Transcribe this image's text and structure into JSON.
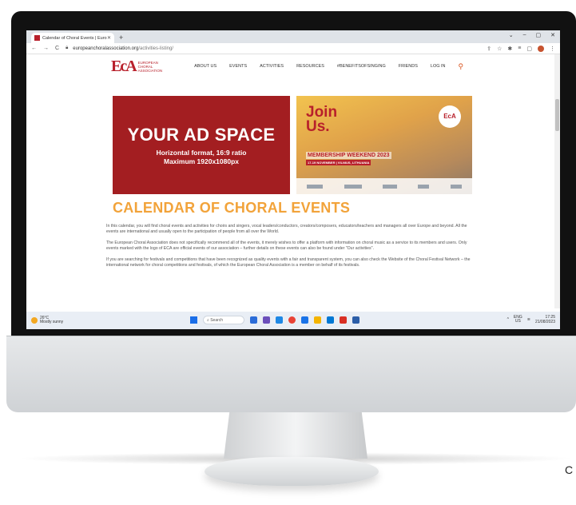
{
  "browser": {
    "tab_title": "Calendar of Choral Events | Euro",
    "tab_close": "✕",
    "new_tab": "+",
    "window_controls": [
      "⌄",
      "–",
      "▢",
      "✕"
    ],
    "back": "←",
    "forward": "→",
    "reload": "C",
    "url_host": "europeanchoralassociation.org",
    "url_path": "/activities-listing/",
    "addr_icons": [
      "⇪",
      "☆",
      "✱",
      "≡",
      "▢"
    ]
  },
  "site": {
    "logo_mark": "EcA",
    "logo_lines": [
      "EUROPEAN",
      "CHORAL",
      "ASSOCIATION"
    ],
    "nav": [
      "ABOUT US",
      "EVENTS",
      "ACTIVITIES",
      "RESOURCES",
      "#BENEFITSOFSINGING",
      "FRIENDS",
      "LOG IN"
    ]
  },
  "ad": {
    "headline": "YOUR AD SPACE",
    "line1": "Horizontal format, 16:9 ratio",
    "line2": "Maximum 1920x1080px"
  },
  "join": {
    "title_line1": "Join",
    "title_line2": "Us.",
    "badge": "EcA",
    "event": "MEMBERSHIP WEEKEND 2023",
    "date": "17-19 NOVEMBER | VILNIUS, LITHUANIA"
  },
  "page": {
    "heading": "CALENDAR OF CHORAL EVENTS",
    "paragraphs": [
      "In this calendar, you will find choral events and activities for choirs and singers, vocal leaders/conductors, creators/composers, educators/teachers and managers all over Europe and beyond. All the events are international and usually open to the participation of people from all over the World.",
      "The European Choral Association does not specifically recommend all of the events, it merely wishes to offer a platform with information on choral music as a service to its members and users. Only events marked with the logo of ECA are official events of our association – further details on these events can also be found under \"Our activities\".",
      "If you are searching for festivals and competitions that have been recognized as quality events with a fair and transparent system, you can also check the Website of the Choral Festival Network – the international network for choral competitions and festivals, of which the European Choral Association is a member on behalf of its festivals."
    ]
  },
  "taskbar": {
    "temp": "26°C",
    "weather": "Mostly sunny",
    "search": "Search",
    "lang": "ENG",
    "region": "US",
    "time": "17:25",
    "date": "21/08/2023"
  },
  "corner_text": "C"
}
